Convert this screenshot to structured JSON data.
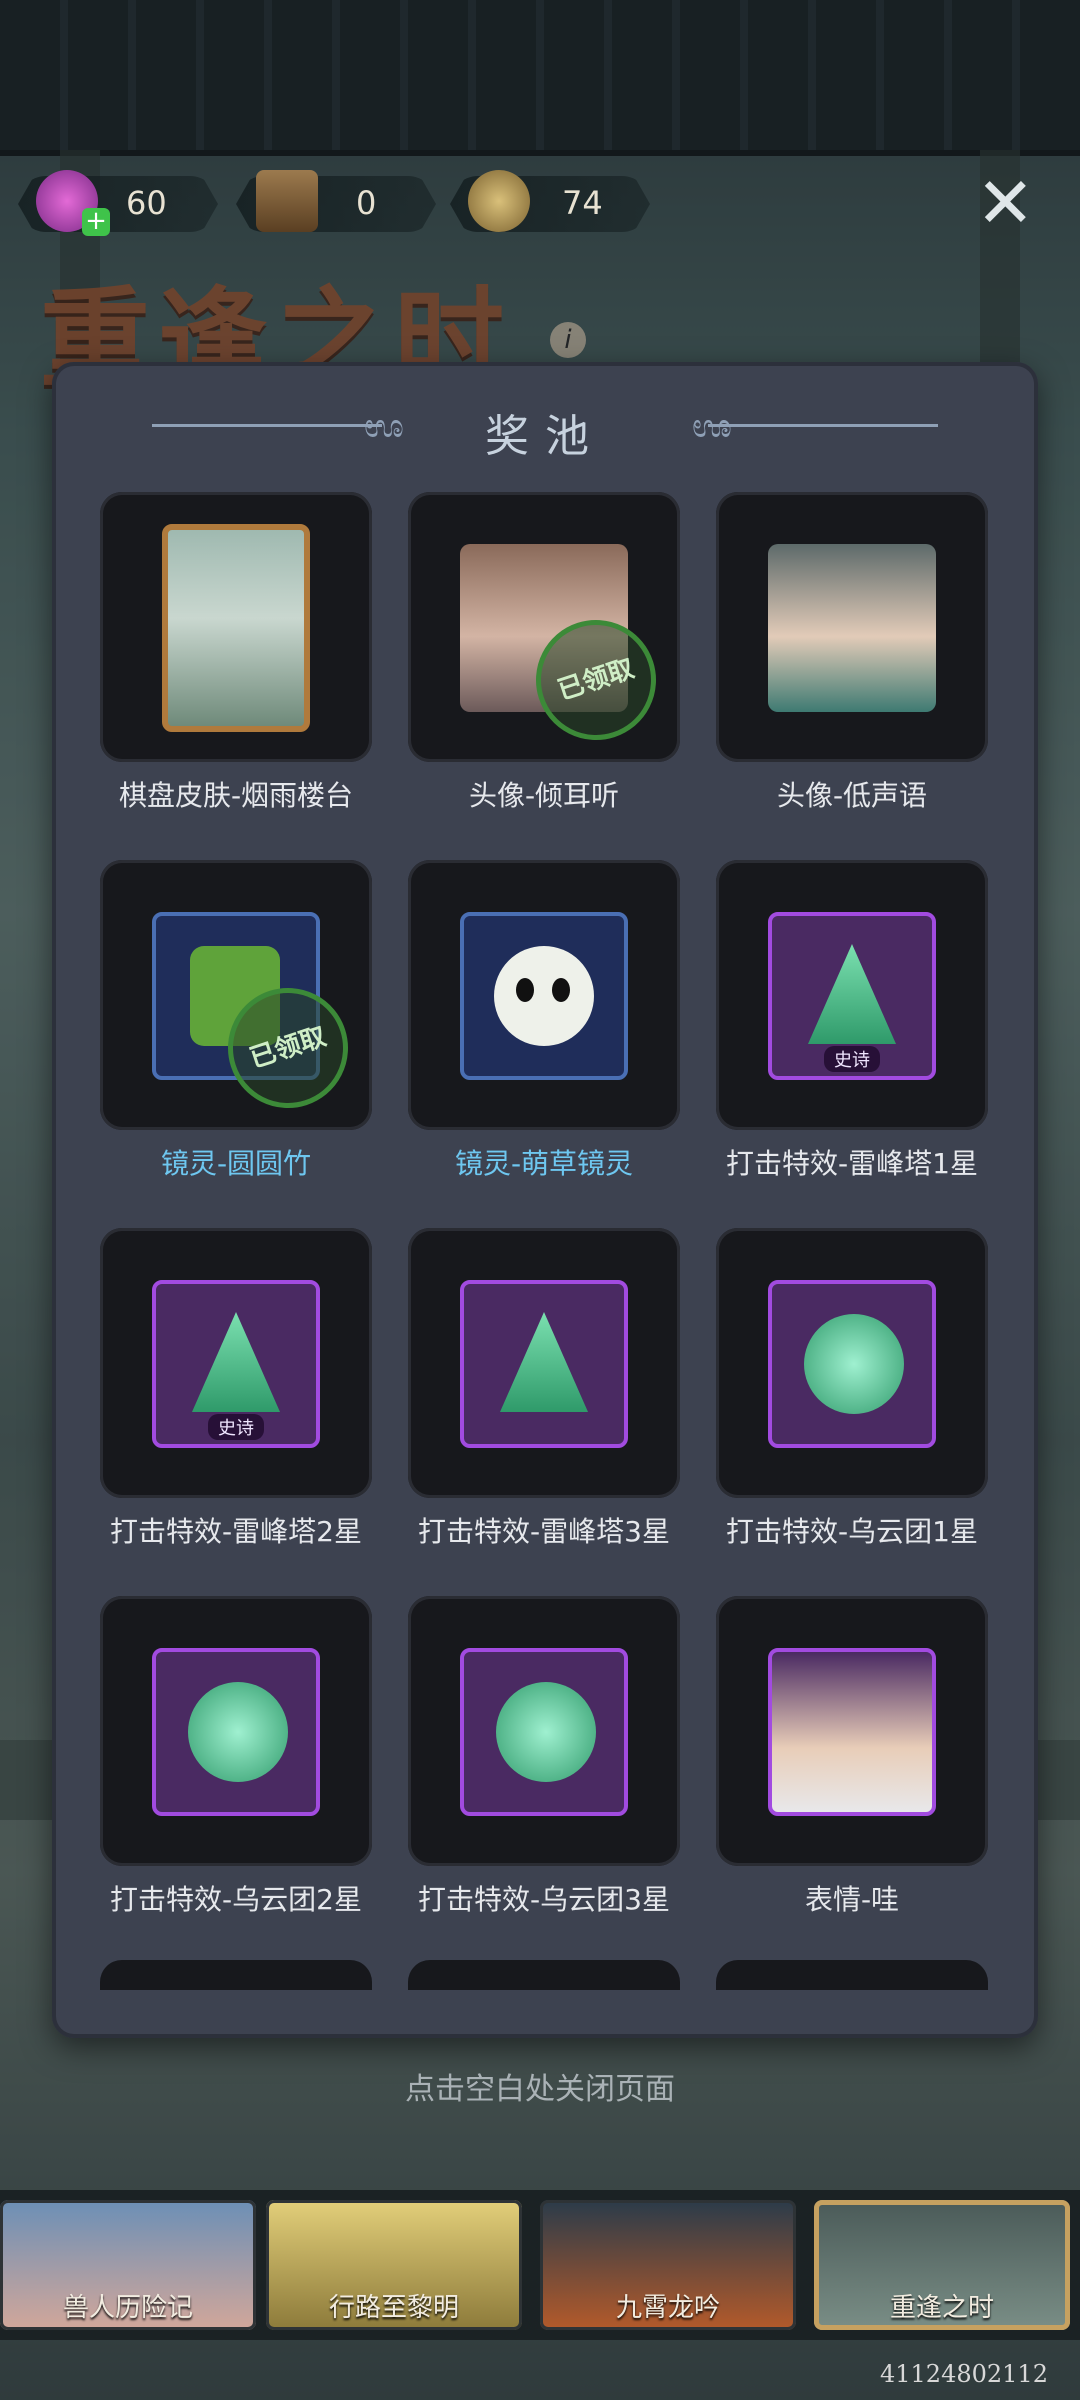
{
  "currency": [
    {
      "icon": "candy-icon",
      "value": "60"
    },
    {
      "icon": "book-icon",
      "value": "0"
    },
    {
      "icon": "coin-icon",
      "value": "74"
    }
  ],
  "event_title": "重逢之时",
  "panel_title": "奖池",
  "rewards": [
    {
      "label": "棋盘皮肤-烟雨楼台",
      "kind": "skin"
    },
    {
      "label": "头像-倾耳听",
      "kind": "avatar",
      "claimed": "已领取"
    },
    {
      "label": "头像-低声语",
      "kind": "avatar"
    },
    {
      "label": "镜灵-圆圆竹",
      "kind": "sprite",
      "claimed": "已领取"
    },
    {
      "label": "镜灵-萌草镜灵",
      "kind": "sprite"
    },
    {
      "label": "打击特效-雷峰塔1星",
      "kind": "effect",
      "rarity": "史诗"
    },
    {
      "label": "打击特效-雷峰塔2星",
      "kind": "effect",
      "rarity": "史诗"
    },
    {
      "label": "打击特效-雷峰塔3星",
      "kind": "effect"
    },
    {
      "label": "打击特效-乌云团1星",
      "kind": "effect"
    },
    {
      "label": "打击特效-乌云团2星",
      "kind": "effect"
    },
    {
      "label": "打击特效-乌云团3星",
      "kind": "effect"
    },
    {
      "label": "表情-哇",
      "kind": "emote"
    }
  ],
  "close_hint": "点击空白处关闭页面",
  "tabs": [
    {
      "label": "兽人历险记"
    },
    {
      "label": "行路至黎明"
    },
    {
      "label": "九霄龙吟"
    },
    {
      "label": "重逢之时"
    }
  ],
  "user_id": "41124802112",
  "colors": {
    "accent_epic": "#a24be0",
    "accent_sprite": "#4a6fb4",
    "claimed_green": "#3c8a38"
  }
}
